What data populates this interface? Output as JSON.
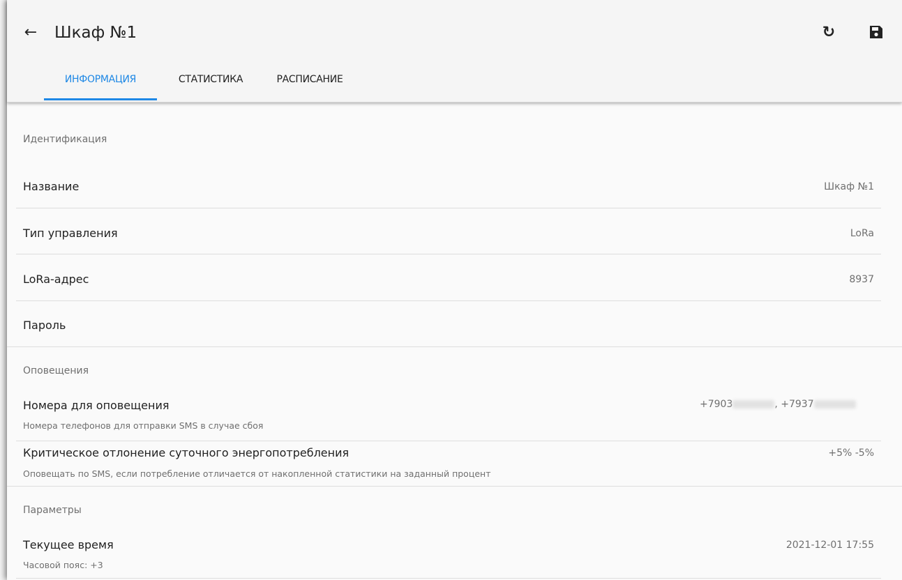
{
  "header": {
    "back_icon": "arrow-left-icon",
    "title": "Шкаф №1",
    "refresh_icon": "refresh-icon",
    "save_icon": "floppy-disk-icon",
    "accent_color": "#1e88e5"
  },
  "tabs": [
    {
      "label": "ИНФОРМАЦИЯ",
      "active": true
    },
    {
      "label": "СТАТИСТИКА",
      "active": false
    },
    {
      "label": "РАСПИСАНИЕ",
      "active": false
    }
  ],
  "sections": {
    "identification": {
      "header": "Идентификация",
      "name": {
        "label": "Название",
        "value": "Шкаф №1"
      },
      "control_type": {
        "label": "Тип управления",
        "value": "LoRa"
      },
      "lora_address": {
        "label": "LoRa-адрес",
        "value": "8937"
      },
      "password": {
        "label": "Пароль",
        "value": ""
      }
    },
    "notifications": {
      "header": "Оповещения",
      "phones": {
        "label": "Номера для оповещения",
        "description": "Номера телефонов для отправки SMS в случае сбоя",
        "phone1_prefix": "+7903",
        "separator": ", ",
        "phone2_prefix": "+7937"
      },
      "deviation": {
        "label": "Критическое отлонение суточного энергопотребления",
        "description": "Оповещать по SMS, если потребление отличается от накопленной статистики на заданный процент",
        "value": "+5% -5%"
      }
    },
    "parameters": {
      "header": "Параметры",
      "current_time": {
        "label": "Текущее время",
        "description": "Часовой пояс: +3",
        "value": "2021-12-01 17:55"
      }
    }
  }
}
